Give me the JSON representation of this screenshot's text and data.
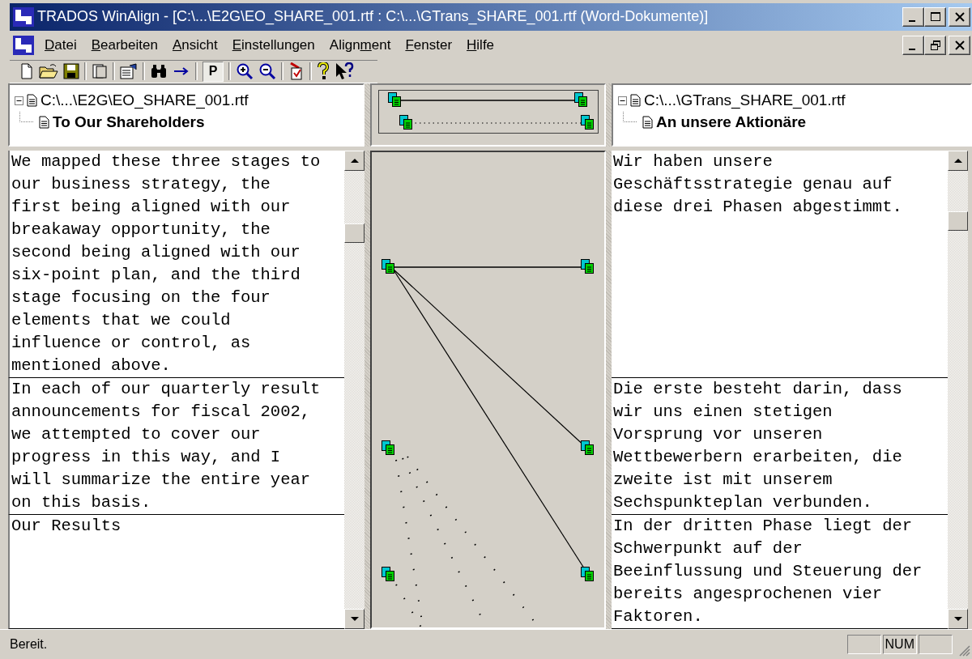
{
  "window": {
    "title": "TRADOS WinAlign - [C:\\...\\E2G\\EO_SHARE_001.rtf : C:\\...\\GTrans_SHARE_001.rtf (Word-Dokumente)]"
  },
  "menu": [
    {
      "key": "D",
      "after": "atei"
    },
    {
      "key": "B",
      "after": "earbeiten"
    },
    {
      "key": "A",
      "after": "nsicht"
    },
    {
      "key": "E",
      "after": "instellungen"
    },
    {
      "before": "Align",
      "key": "m",
      "after": "ent"
    },
    {
      "key": "F",
      "after": "enster"
    },
    {
      "key": "H",
      "after": "ilfe"
    }
  ],
  "toolbar": {
    "toggle": {
      "label": "P",
      "selected": true
    }
  },
  "source_tree": {
    "path": "C:\\...\\E2G\\EO_SHARE_001.rtf",
    "expanded": true,
    "children": [
      {
        "label": "To Our Shareholders"
      }
    ]
  },
  "target_tree": {
    "path": "C:\\...\\GTrans_SHARE_001.rtf",
    "expanded": true,
    "children": [
      {
        "label": "An unsere Aktionäre"
      }
    ]
  },
  "segments": [
    {
      "source": "We mapped these three stages to our business strategy, the first being aligned with our breakaway opportunity, the second being aligned with our six-point plan, and the third stage focusing on the four elements that we could influence or control, as mentioned above.",
      "target": "Wir haben unsere Geschäftsstrategie genau auf diese drei Phasen abgestimmt."
    },
    {
      "source": "In each of our quarterly result announcements for fiscal 2002, we attempted to cover our progress in this way, and I will summarize the entire year on this basis.",
      "target": "Die erste besteht darin, dass wir uns einen stetigen Vorsprung vor unseren Wettbewerbern erarbeiten, die zweite ist mit unserem Sechspunkteplan verbunden."
    },
    {
      "source": "Our Results",
      "target": "In der dritten Phase liegt der Schwerpunkt auf der Beeinflussung und Steuerung der bereits angesprochenen vier Faktoren."
    }
  ],
  "status_bar": {
    "text": "Bereit.",
    "indicator": "NUM"
  }
}
